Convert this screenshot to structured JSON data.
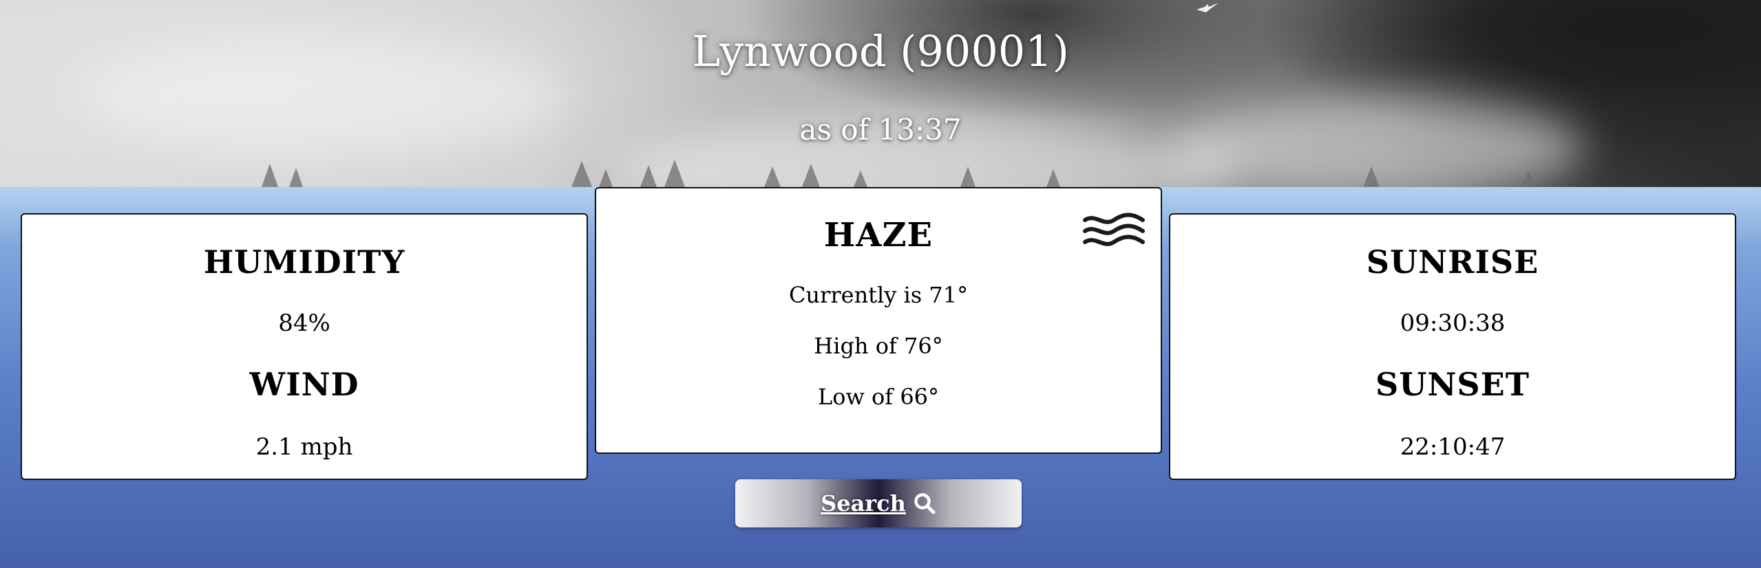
{
  "header": {
    "location": "Lynwood (90001)",
    "as_of": "as of 13:37"
  },
  "left_card": {
    "humidity_label": "HUMIDITY",
    "humidity_value": "84%",
    "wind_label": "WIND",
    "wind_value": "2.1 mph"
  },
  "center_card": {
    "condition": "HAZE",
    "icon": "haze-icon",
    "current": "Currently is 71°",
    "high": "High of 76°",
    "low": "Low of 66°"
  },
  "right_card": {
    "sunrise_label": "SUNRISE",
    "sunrise_value": "09:30:38",
    "sunset_label": "SUNSET",
    "sunset_value": "22:10:47"
  },
  "search": {
    "label": "Search",
    "icon": "search-icon"
  }
}
